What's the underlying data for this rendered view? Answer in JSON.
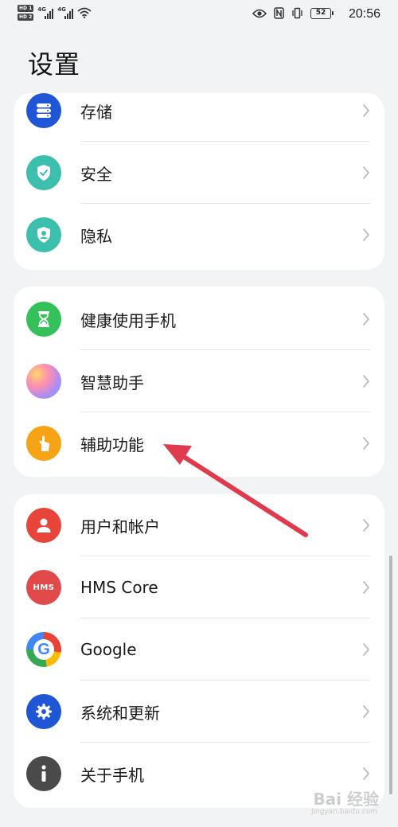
{
  "status_bar": {
    "time": "20:56",
    "battery": "52",
    "sim1": "HD 1",
    "sim2": "HD 2",
    "net1": "4G",
    "net2": "4G"
  },
  "page": {
    "title": "设置"
  },
  "groups": [
    {
      "items": [
        {
          "label": "存储",
          "icon": "storage-icon",
          "color": "#1e56d6"
        },
        {
          "label": "安全",
          "icon": "shield-icon",
          "color": "#3dbfae"
        },
        {
          "label": "隐私",
          "icon": "privacy-icon",
          "color": "#3dbfae"
        }
      ]
    },
    {
      "items": [
        {
          "label": "健康使用手机",
          "icon": "hourglass-icon",
          "color": "#34c15a"
        },
        {
          "label": "智慧助手",
          "icon": "assistant-icon",
          "color": "#b08cf0"
        },
        {
          "label": "辅助功能",
          "icon": "accessibility-hand-icon",
          "color": "#f6a316"
        }
      ]
    },
    {
      "items": [
        {
          "label": "用户和帐户",
          "icon": "user-icon",
          "color": "#e9443a"
        },
        {
          "label": "HMS Core",
          "icon": "hms-core-icon",
          "color": "#e2494a",
          "icon_text": "HMS"
        },
        {
          "label": "Google",
          "icon": "google-icon",
          "color": "#ffffff"
        },
        {
          "label": "系统和更新",
          "icon": "system-update-icon",
          "color": "#1e56d6"
        },
        {
          "label": "关于手机",
          "icon": "info-icon",
          "color": "#4a4a4a"
        }
      ]
    }
  ],
  "watermark": {
    "text": "Bai 经验",
    "sub": "jingyan.baidu.com"
  },
  "colors": {
    "background": "#f1f3f5",
    "card": "#ffffff",
    "annotation_arrow": "#e03a4e"
  }
}
